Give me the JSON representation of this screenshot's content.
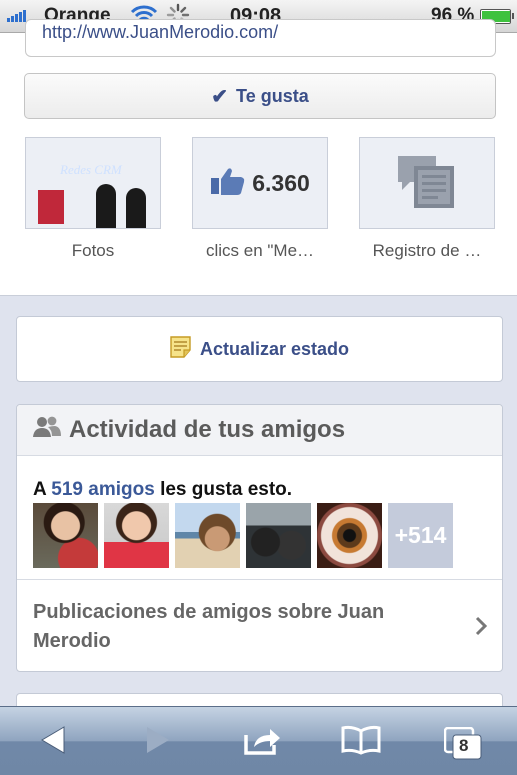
{
  "status_bar": {
    "carrier": "Orange",
    "time": "09:08",
    "battery_percent": "96 %",
    "battery_level": 0.96,
    "wifi_icon": "wifi-icon",
    "activity_icon": "spinner-icon"
  },
  "page": {
    "url_text": "http://www.JuanMerodio.com/",
    "like_button_label": "Te gusta",
    "tiles": [
      {
        "label": "Fotos",
        "icon": "photo-thumbnail"
      },
      {
        "label": "clics en \"Me…",
        "count": "6.360",
        "icon": "thumbs-up-icon"
      },
      {
        "label": "Registro de …",
        "icon": "notes-icon"
      }
    ],
    "photo_screen_text": "Redes CRM"
  },
  "update_status": {
    "label": "Actualizar estado",
    "icon": "note-pencil-icon"
  },
  "friends": {
    "title": "Actividad de tus amigos",
    "likers_prefix": "A ",
    "likers_link": "519 amigos",
    "likers_suffix": " les gusta esto.",
    "more_count": "+514",
    "friend_posts_label": "Publicaciones de amigos sobre Juan Merodio"
  },
  "toolbar": {
    "tab_count": "8",
    "items": [
      "back-icon",
      "forward-icon",
      "share-icon",
      "bookmarks-icon",
      "tabs-icon"
    ]
  },
  "colors": {
    "link_blue": "#3b5998",
    "facebook_blue": "#3b4f88",
    "background": "#dfe3ee"
  }
}
